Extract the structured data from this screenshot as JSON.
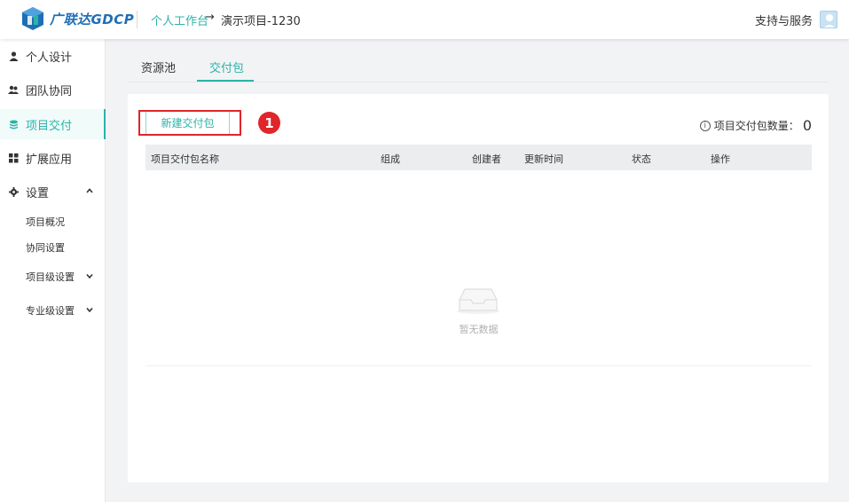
{
  "header": {
    "brand": "广联达GDCP",
    "breadcrumb": {
      "home": "个人工作台",
      "arrow": "→",
      "project": "演示项目-1230"
    },
    "support": "支持与服务"
  },
  "sidebar": {
    "items": [
      {
        "label": "个人设计",
        "icon": "user-icon"
      },
      {
        "label": "团队协同",
        "icon": "team-icon"
      },
      {
        "label": "项目交付",
        "icon": "stack-icon",
        "active": true
      },
      {
        "label": "扩展应用",
        "icon": "grid-icon"
      },
      {
        "label": "设置",
        "icon": "gear-icon",
        "chevron": "^"
      }
    ],
    "sub_items": [
      {
        "label": "项目概况"
      },
      {
        "label": "协同设置"
      },
      {
        "label": "项目级设置",
        "chevron": "v"
      },
      {
        "label": "专业级设置",
        "chevron": "v"
      }
    ]
  },
  "tabs": [
    {
      "label": "资源池"
    },
    {
      "label": "交付包",
      "active": true
    }
  ],
  "toolbar": {
    "new_label": "新建交付包",
    "step": "1",
    "count_label": "项目交付包数量：",
    "count_value": "0"
  },
  "table": {
    "columns": [
      "项目交付包名称",
      "组成",
      "创建者",
      "更新时间",
      "状态",
      "操作"
    ],
    "empty_text": "暂无数据"
  },
  "colors": {
    "accent": "#2bb3a8",
    "highlight": "#e0252b",
    "brand": "#1f6fb5"
  }
}
